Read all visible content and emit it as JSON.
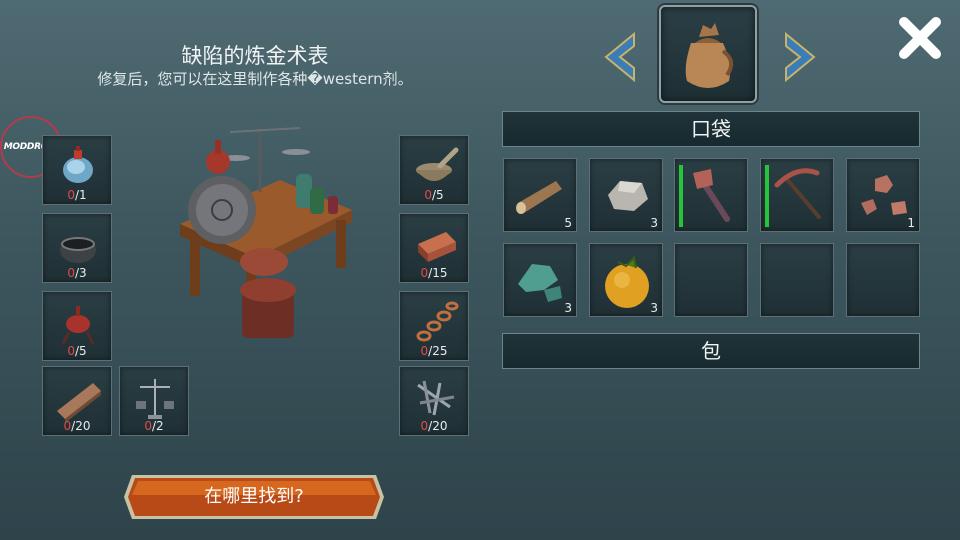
{
  "header": {
    "title": "缺陷的炼金术表",
    "subtitle": "修复后，您可以在这里制作各种�western剂。"
  },
  "watermark": "MODDROID",
  "recipe_left": [
    {
      "icon": "blue-potion-icon",
      "have": "0",
      "need": "/1"
    },
    {
      "icon": "iron-pot-icon",
      "have": "0",
      "need": "/3"
    },
    {
      "icon": "alchemy-burner-icon",
      "have": "0",
      "need": "/5"
    },
    {
      "icon": "wooden-plank-icon",
      "have": "0",
      "need": "/20"
    },
    {
      "icon": "scales-icon",
      "have": "0",
      "need": "/2"
    }
  ],
  "recipe_right": [
    {
      "icon": "mortar-pestle-icon",
      "have": "0",
      "need": "/5"
    },
    {
      "icon": "copper-ingot-icon",
      "have": "0",
      "need": "/15"
    },
    {
      "icon": "copper-chain-icon",
      "have": "0",
      "need": "/25"
    },
    {
      "icon": "nails-icon",
      "have": "0",
      "need": "/20"
    }
  ],
  "selector": {
    "icon": "pouch-icon",
    "prev": "chevron-left-icon",
    "next": "chevron-right-icon"
  },
  "close_icon": "close-icon",
  "pocket_label": "口袋",
  "bag_label": "包",
  "inventory": [
    {
      "icon": "wood-log-icon",
      "qty": "5"
    },
    {
      "icon": "stone-icon",
      "qty": "3"
    },
    {
      "icon": "stone-axe-icon",
      "qty": "",
      "durability": 1.0
    },
    {
      "icon": "pickaxe-icon",
      "qty": "",
      "durability": 1.0
    },
    {
      "icon": "copper-ore-icon",
      "qty": "1"
    },
    {
      "icon": "malachite-icon",
      "qty": "3"
    },
    {
      "icon": "orange-fruit-icon",
      "qty": "3"
    },
    {
      "icon": "",
      "qty": ""
    },
    {
      "icon": "",
      "qty": ""
    },
    {
      "icon": "",
      "qty": ""
    }
  ],
  "find_button": "在哪里找到?",
  "colors": {
    "accent_orange": "#c4561a",
    "durability_green": "#27c43a",
    "missing_red": "#e24a4a",
    "banner_bg": "#1b2e33"
  }
}
